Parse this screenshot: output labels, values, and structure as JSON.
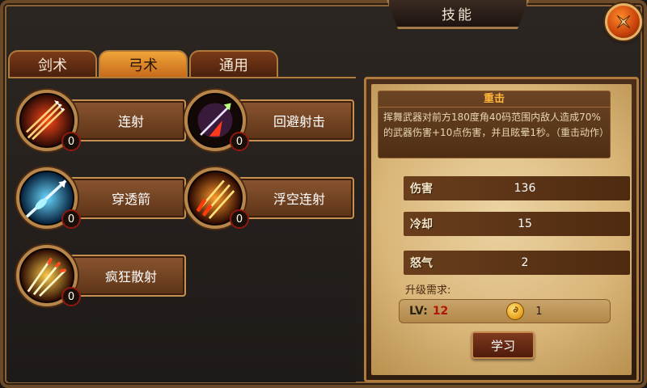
{
  "header": {
    "title": "技能"
  },
  "tabs": [
    {
      "label": "剑术",
      "active": false
    },
    {
      "label": "弓术",
      "active": true
    },
    {
      "label": "通用",
      "active": false
    }
  ],
  "skills": [
    {
      "name": "连射",
      "count": "0",
      "icon": "multi-arrow-icon"
    },
    {
      "name": "回避射击",
      "count": "0",
      "icon": "evade-shot-icon"
    },
    {
      "name": "穿透箭",
      "count": "0",
      "icon": "pierce-arrow-icon"
    },
    {
      "name": "浮空连射",
      "count": "0",
      "icon": "air-barrage-icon"
    },
    {
      "name": "疯狂散射",
      "count": "0",
      "icon": "frenzy-scatter-icon"
    }
  ],
  "detail": {
    "title": "重击",
    "description": "挥舞武器对前方180度角40码范围内敌人造成70%的武器伤害+10点伤害，并且眩晕1秒。（重击动作）",
    "stats": [
      {
        "label": "伤害",
        "value": "136"
      },
      {
        "label": "冷却",
        "value": "15"
      },
      {
        "label": "怒气",
        "value": "2"
      }
    ],
    "requirement_label": "升级需求:",
    "level_label": "LV:",
    "level_value": "12",
    "coin_value": "1",
    "learn_label": "学习"
  },
  "colors": {
    "accent": "#f0a53a",
    "level": "#b3140c",
    "title": "#ffb63a"
  }
}
